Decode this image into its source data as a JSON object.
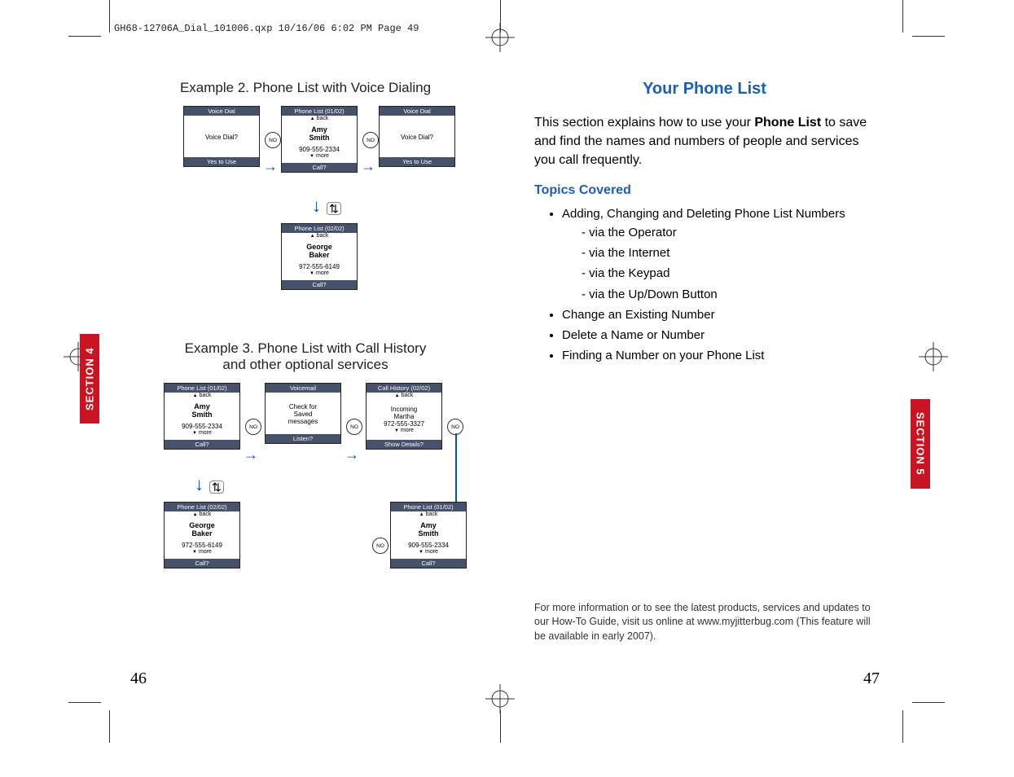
{
  "crop_header": "GH68-12706A_Dial_101006.qxp  10/16/06  6:02 PM  Page 49",
  "left": {
    "section_tab": "SECTION 4",
    "page_num": "46",
    "example2_title": "Example 2. Phone List with Voice Dialing",
    "example3_line1": "Example 3. Phone List with Call History",
    "example3_line2": "and other optional services",
    "screens_ex2": {
      "s1": {
        "title": "Voice Dial",
        "line1": "Voice Dial?",
        "foot": "Yes to Use"
      },
      "s2": {
        "title": "Phone List (01/02)",
        "sub": "back",
        "name1": "Amy",
        "name2": "Smith",
        "phone": "909-555-2334",
        "more": "more",
        "foot": "Call?"
      },
      "s3": {
        "title": "Voice Dial",
        "line1": "Voice Dial?",
        "foot": "Yes to Use"
      },
      "s4": {
        "title": "Phone List (02/02)",
        "sub": "back",
        "name1": "George",
        "name2": "Baker",
        "phone": "972-555-6149",
        "more": "more",
        "foot": "Call?"
      }
    },
    "screens_ex3": {
      "s1": {
        "title": "Phone List (01/02)",
        "sub": "back",
        "name1": "Amy",
        "name2": "Smith",
        "phone": "909-555-2334",
        "more": "more",
        "foot": "Call?"
      },
      "s2": {
        "title": "Voicemail",
        "l1": "Check for",
        "l2": "Saved",
        "l3": "messages",
        "foot": "Listen?"
      },
      "s3": {
        "title": "Call History (02/02)",
        "sub": "back",
        "l1": "Incoming",
        "l2": "Martha",
        "l3": "972-555-3327",
        "more": "more",
        "foot": "Show Details?"
      },
      "s4": {
        "title": "Phone List (02/02)",
        "sub": "back",
        "name1": "George",
        "name2": "Baker",
        "phone": "972-555-6149",
        "more": "more",
        "foot": "Call?"
      },
      "s5": {
        "title": "Phone List (01/02)",
        "sub": "back",
        "name1": "Amy",
        "name2": "Smith",
        "phone": "909-555-2334",
        "more": "more",
        "foot": "Call?"
      }
    },
    "no_label": "NO"
  },
  "right": {
    "section_tab": "SECTION 5",
    "page_num": "47",
    "title": "Your Phone List",
    "intro_pre": "This section explains how to use your ",
    "intro_bold": "Phone List",
    "intro_post": " to save and find the names and numbers of people and services you call frequently.",
    "topics_head": "Topics Covered",
    "bullets": [
      "Adding, Changing and Deleting Phone List Numbers",
      "Change an Existing Number",
      "Delete a Name or Number",
      "Finding a Number on your Phone List"
    ],
    "sub_bullets": [
      "via the Operator",
      "via the Internet",
      "via the Keypad",
      "via the Up/Down Button"
    ],
    "footer": "For more information or to see the latest products, services and updates to our How-To Guide, visit us online at www.myjitterbug.com (This feature will be available in early 2007)."
  }
}
